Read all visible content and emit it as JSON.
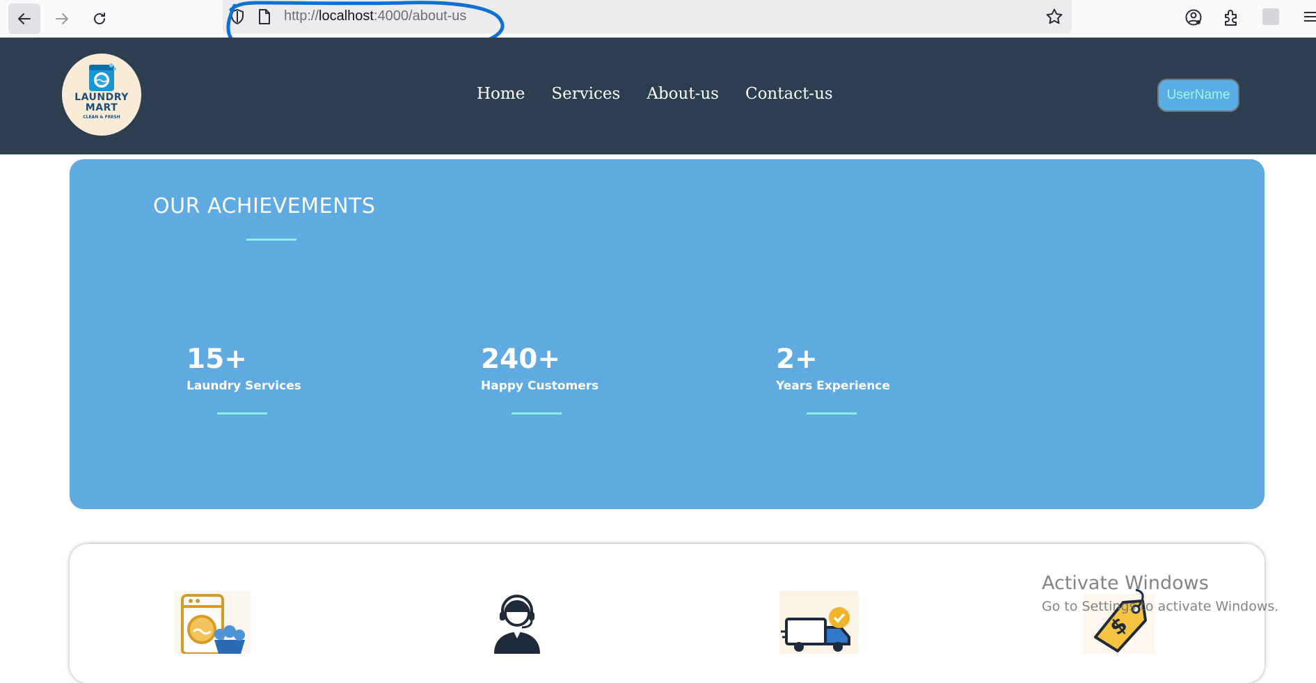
{
  "browser": {
    "url_prefix": "http://",
    "url_host": "localhost",
    "url_rest": ":4000/about-us",
    "icons": [
      "back-arrow-icon",
      "forward-arrow-icon",
      "reload-icon",
      "shield-icon",
      "page-icon",
      "star-icon",
      "account-icon",
      "extensions-icon",
      "extension-icon",
      "menu-icon"
    ]
  },
  "header": {
    "logo": {
      "line1": "LAUNDRY",
      "line2": "MART",
      "line3": "CLEAN & FRESH"
    },
    "nav": [
      {
        "label": "Home"
      },
      {
        "label": "Services"
      },
      {
        "label": "About-us"
      },
      {
        "label": "Contact-us"
      }
    ],
    "user_button": "UserName"
  },
  "achievements": {
    "title": "OUR ACHIEVEMENTS",
    "stats": [
      {
        "value": "15+",
        "label": "Laundry Services"
      },
      {
        "value": "240+",
        "label": "Happy Customers"
      },
      {
        "value": "2+",
        "label": "Years Experience"
      }
    ]
  },
  "features": {
    "icons": [
      "washing-machine-icon",
      "customer-support-icon",
      "delivery-truck-icon",
      "price-tag-icon"
    ]
  },
  "watermark": {
    "title": "Activate Windows",
    "subtitle": "Go to Settings to activate Windows."
  },
  "colors": {
    "header_bg": "#2e3e51",
    "panel_bg": "#5eaae1",
    "accent_line": "#8ef1e8",
    "user_button_bg": "#5aaee3",
    "user_button_text": "#a6f1ee"
  }
}
